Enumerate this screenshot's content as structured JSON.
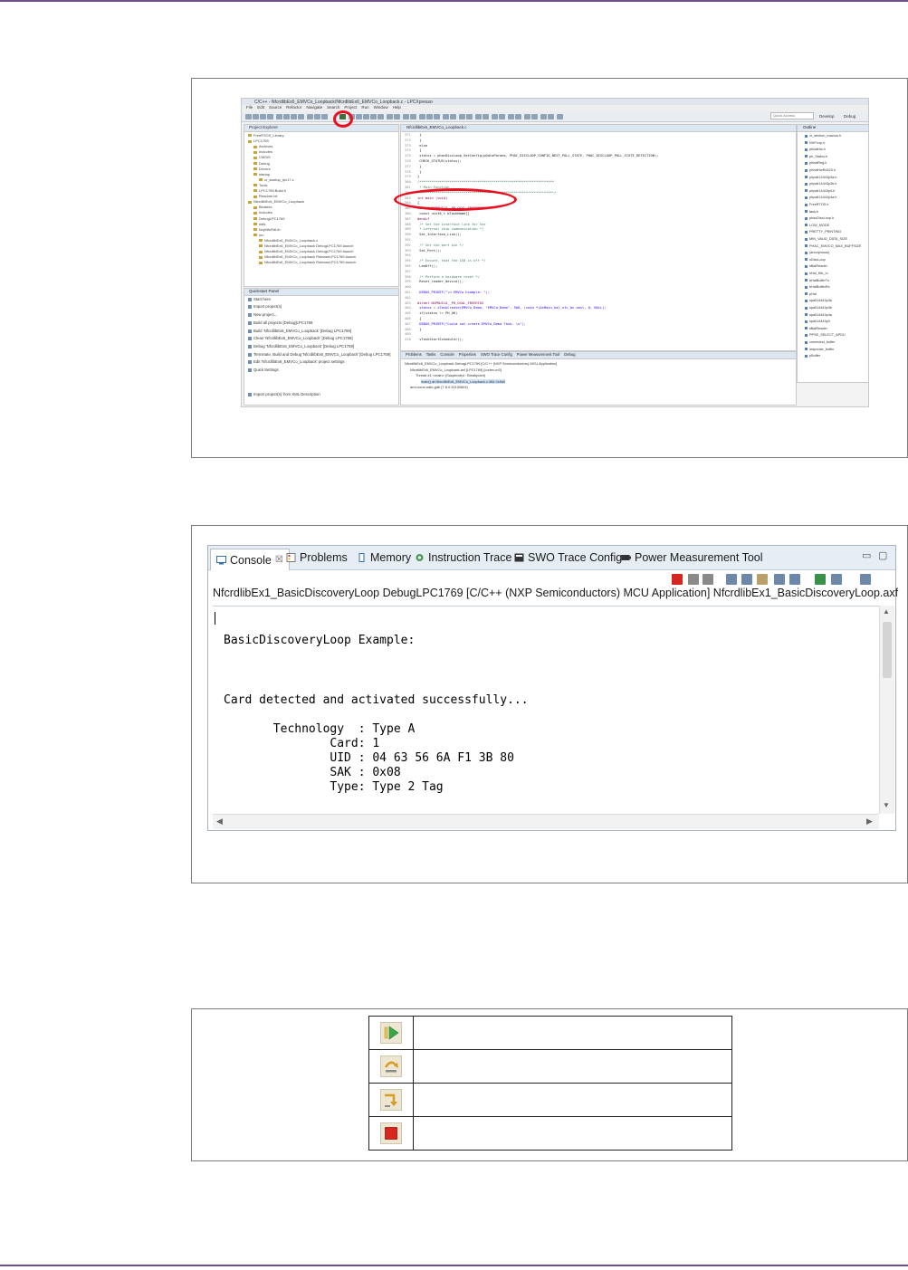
{
  "ide": {
    "title": "C/C++ - NfcrdlibEx6_EMVCo_Loopback/NfcrdlibEx6_EMVCo_Loopback.c - LPCXpresso",
    "menus": [
      "File",
      "Edit",
      "Source",
      "Refactor",
      "Navigate",
      "Search",
      "Project",
      "Run",
      "Window",
      "Help"
    ],
    "quick_access": "Quick Access",
    "perspectives": [
      "Develop",
      "Debug"
    ],
    "project_explorer_tab": "Project Explorer",
    "project_tree": [
      "FreeRTOS_Library",
      "LPC1769",
      "Archives",
      "Includes",
      "CMSIS",
      "Debug",
      "Drivers",
      "startup",
      "cr_startup_lpc17.c",
      "Tools",
      "LPC1769.Build.h",
      "Readme.txt",
      "NfcrdlibEx6_EMVCo_Loopback",
      "Binaries",
      "Includes",
      "DebugLPC1769",
      "intfs",
      "NxpNfcRdLib",
      "src",
      "NfcrdlibEx6_EMVCo_Loopback.c",
      "NfcrdlibEx6_EMVCo_Loopback DebugLPC1769.launch",
      "NfcrdlibEx6_EMVCo_Loopback DebugLPC1769.launch",
      "NfcrdlibEx6_EMVCo_Loopback ReleaseLPC1769.launch",
      "NfcrdlibEx6_EMVCo_Loopback ReleaseLPC1769.launch"
    ],
    "quickstart_tab": "Quickstart Panel",
    "quickstart_items": [
      "Start here",
      "Import project(s)",
      "New project...",
      "Build all projects [Debug]LPC1769",
      "Build 'NfcrdlibEx6_EMVCo_Loopback' [Debug LPC1769]",
      "Clean 'NfcrdlibEx6_EMVCo_Loopback' [Debug LPC1769]",
      "Debug 'NfcrdlibEx6_EMVCo_Loopback' [Debug LPC1769]",
      "Terminate, Build and Debug 'NfcrdlibEx6_EMVCo_Loopback' [Debug LPC1769]",
      "Edit 'NfcrdlibEx6_EMVCo_Loopback' project settings",
      "Quick Settings",
      "Import project(s) from XML Description"
    ],
    "editor_tab": "NfcrdlibEx6_EMVCo_Loopback.c",
    "code_lines": [
      {
        "n": "371",
        "t": "            }"
      },
      {
        "n": "372",
        "t": "        }"
      },
      {
        "n": "373",
        "t": "        else"
      },
      {
        "n": "374",
        "t": "        {"
      },
      {
        "n": "375",
        "t": "            status = phacDiscLoop_SetConfig(pDataParams, PHAC_DISCLOOP_CONFIG_NEXT_POLL_STATE, PHAC_DISCLOOP_POLL_STATE_DETECTION);"
      },
      {
        "n": "376",
        "t": "            CHECK_STATUS(status);"
      },
      {
        "n": "377",
        "t": "        }"
      },
      {
        "n": "378",
        "t": "    }"
      },
      {
        "n": "379",
        "t": "}"
      },
      {
        "n": "380",
        "t": "/*******************************************************************"
      },
      {
        "n": "381",
        "t": " *   Main Function"
      },
      {
        "n": "382",
        "t": " *******************************************************************/"
      },
      {
        "n": "383",
        "t": "int main (void)"
      },
      {
        "n": "384",
        "t": "{"
      },
      {
        "n": "385",
        "t": "#ifdef NXPBUILD__PH_OSAL_FREERTOS"
      },
      {
        "n": "386",
        "t": "    const uint8_t bTaskName[]"
      },
      {
        "n": "387",
        "t": "#endif"
      },
      {
        "n": "388",
        "t": "    /* Set the interface link for the"
      },
      {
        "n": "389",
        "t": "     * internal chip communication */"
      },
      {
        "n": "390",
        "t": "    Set_Interface_Link();"
      },
      {
        "n": "391",
        "t": ""
      },
      {
        "n": "392",
        "t": "    /* Set the port pin */"
      },
      {
        "n": "393",
        "t": "    Set_Port();"
      },
      {
        "n": "394",
        "t": ""
      },
      {
        "n": "395",
        "t": "    /* Ensure, that the LED is off */"
      },
      {
        "n": "396",
        "t": "    LedOff();"
      },
      {
        "n": "397",
        "t": ""
      },
      {
        "n": "398",
        "t": "    /* Perform a hardware reset */"
      },
      {
        "n": "399",
        "t": "    Reset_reader_device();"
      },
      {
        "n": "400",
        "t": ""
      },
      {
        "n": "401",
        "t": "    DEBUG_PRINTF(\"\\n EMVCo Example: \");"
      },
      {
        "n": "402",
        "t": ""
      },
      {
        "n": "403",
        "t": "#ifdef NXPBUILD__PH_OSAL_FREERTOS"
      },
      {
        "n": "404",
        "t": "    status = xTaskCreate(EMVCo_Demo, \"EMVCo_Demo\", 500, (void *)&sMain_hal_nfc_bc.cmsl, 0, NULL);"
      },
      {
        "n": "405",
        "t": "    if(status != PH_OK)"
      },
      {
        "n": "406",
        "t": "    {"
      },
      {
        "n": "407",
        "t": "        DEBUG_PRINTF(\"Could not create EMVCo_Demo Task. \\n\");"
      },
      {
        "n": "408",
        "t": "    }"
      },
      {
        "n": "409",
        "t": ""
      },
      {
        "n": "410",
        "t": "    vTaskStartScheduler();"
      }
    ],
    "outline_tab": "Outline",
    "outline_items": [
      "cr_section_macros.h",
      "NXP/crp.h",
      "phhalHw.h",
      "ph_Status.h",
      "phbalReg.h",
      "phhalHwRc523.h",
      "phpalI14443p3a.h",
      "phpalI14443p3b.h",
      "phpalI14443p4.h",
      "phpalI14443p4a.h",
      "FreeRTOS.h",
      "task.h",
      "phacDiscLoop.h",
      "LOW_MODE",
      "PRETTY_PRINTING",
      "MIN_VALID_DATA_SIZE",
      "PHAC_EMVCO_MAX_BUFFSIZE",
      "(anonymous)",
      "sDiscLoop",
      "sBalReader",
      "sHal_Nfc_Ic",
      "bHalBufferTx",
      "bHalBufferRx",
      "pHal",
      "spalI14443p3a",
      "spalI14443p3b",
      "spalI14443p4a",
      "spalI14443p4",
      "sBalReader",
      "PPSE_SELECT_APDU",
      "command_buffer",
      "response_buffer",
      "pBuffer"
    ],
    "bottom_tabs": [
      "Problems",
      "Tasks",
      "Console",
      "Properties",
      "SWO Trace Config",
      "Power Measurement Tool",
      "Debug"
    ],
    "debug_lines": [
      "NfcrdlibEx6_EMVCo_Loopback DebugLPC1769 [C/C++ (NXP Semiconductors) MCU Application]",
      "NfcrdlibEx6_EMVCo_Loopback.axf [LPC1769] [cortex-m3]",
      "Thread #1 <main> (Suspended : Breakpoint)",
      "main() at NfcrdlibEx6_EMVCo_Loopback.c:384 0x5d0",
      "arm-none-eabi-gdb (7.8.0.20150604)"
    ]
  },
  "console": {
    "tabs": [
      "Console",
      "Problems",
      "Memory",
      "Instruction Trace",
      "SWO Trace Config",
      "Power Measurement Tool"
    ],
    "close_glyph": "☒",
    "minimize_glyph": "▭",
    "maximize_glyph": "▢",
    "description": "NfcrdlibEx1_BasicDiscoveryLoop DebugLPC1769 [C/C++ (NXP Semiconductors) MCU Application] NfcrdlibEx1_BasicDiscoveryLoop.axf",
    "output_lines": [
      "BasicDiscoveryLoop Example:",
      "Card detected and activated successfully...",
      "       Technology  : Type A",
      "               Card: 1",
      "               UID : 04 63 56 6A F1 3B 80",
      "               SAK : 0x08",
      "               Type: Type 2 Tag"
    ]
  },
  "debug_buttons": [
    {
      "icon": "resume-icon",
      "description": ""
    },
    {
      "icon": "step-over-icon",
      "description": ""
    },
    {
      "icon": "step-return-icon",
      "description": ""
    },
    {
      "icon": "terminate-icon",
      "description": ""
    }
  ],
  "colors": {
    "accent_purple": "#6b4e8a",
    "highlight_red": "#e8101e",
    "terminate_red": "#d7261e",
    "resume_green": "#3aa64a",
    "step_orange": "#d99a1e"
  }
}
